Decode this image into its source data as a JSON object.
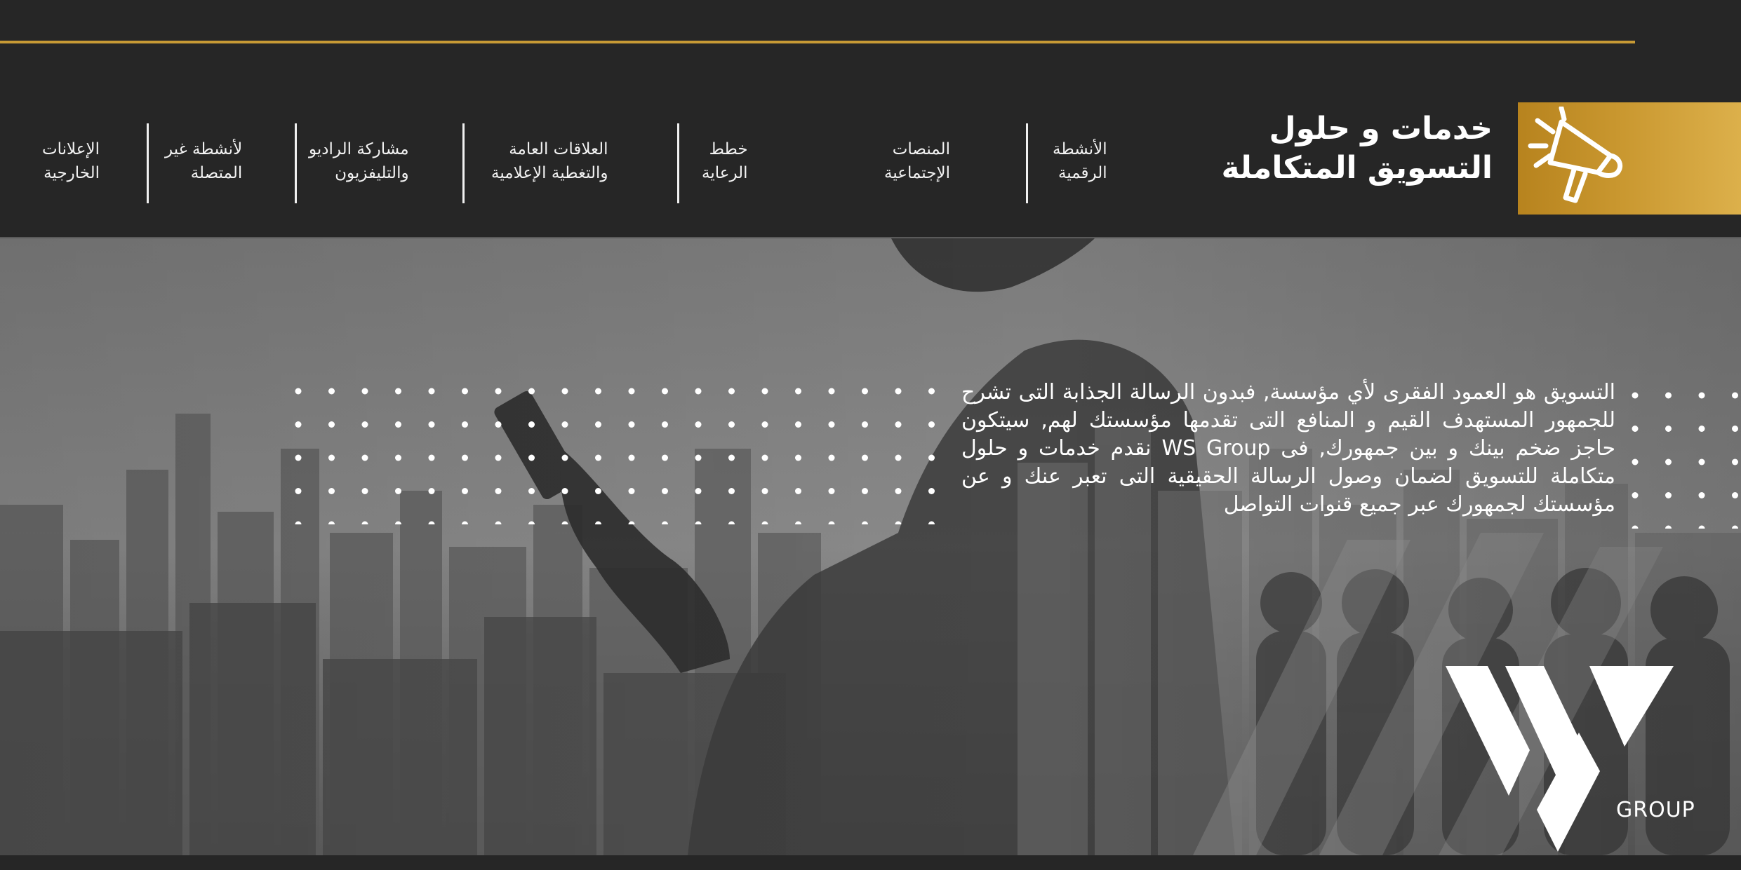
{
  "brand": {
    "title": "خدمات و حلول\nالتسويق المتكاملة",
    "badge_icon": "megaphone-icon",
    "accent_color": "#c79a35"
  },
  "nav": {
    "items": [
      {
        "label": "الأنشطة\nالرقمية"
      },
      {
        "label": "المنصات\nالإجتماعية"
      },
      {
        "label": "خطط\nالرعاية"
      },
      {
        "label": "العلاقات العامة\nوالتغطية الإعلامية"
      },
      {
        "label": "مشاركة الراديو\nوالتليفزيون"
      },
      {
        "label": "لأنشطة غير\nالمتصلة"
      },
      {
        "label": "الإعلانات\nالخارجية"
      }
    ]
  },
  "hero": {
    "paragraph": "التسويق هو العمود الفقرى لأي مؤسسة, فبدون الرسالة الجذابة التى تشرح للجمهور المستهدف القيم و المنافع التى تقدمها مؤسستك لهم, سيتكون حاجز ضخم بينك و بين جمهورك, فى WS Group نقدم خدمات و حلول متكاملة للتسويق لضمان وصول الرسالة الحقيقية التى تعبر عنك و عن مؤسستك لجمهورك عبر جميع قنوات التواصل"
  },
  "logo": {
    "group_text": "GROUP",
    "icon": "ws-logo-icon"
  }
}
